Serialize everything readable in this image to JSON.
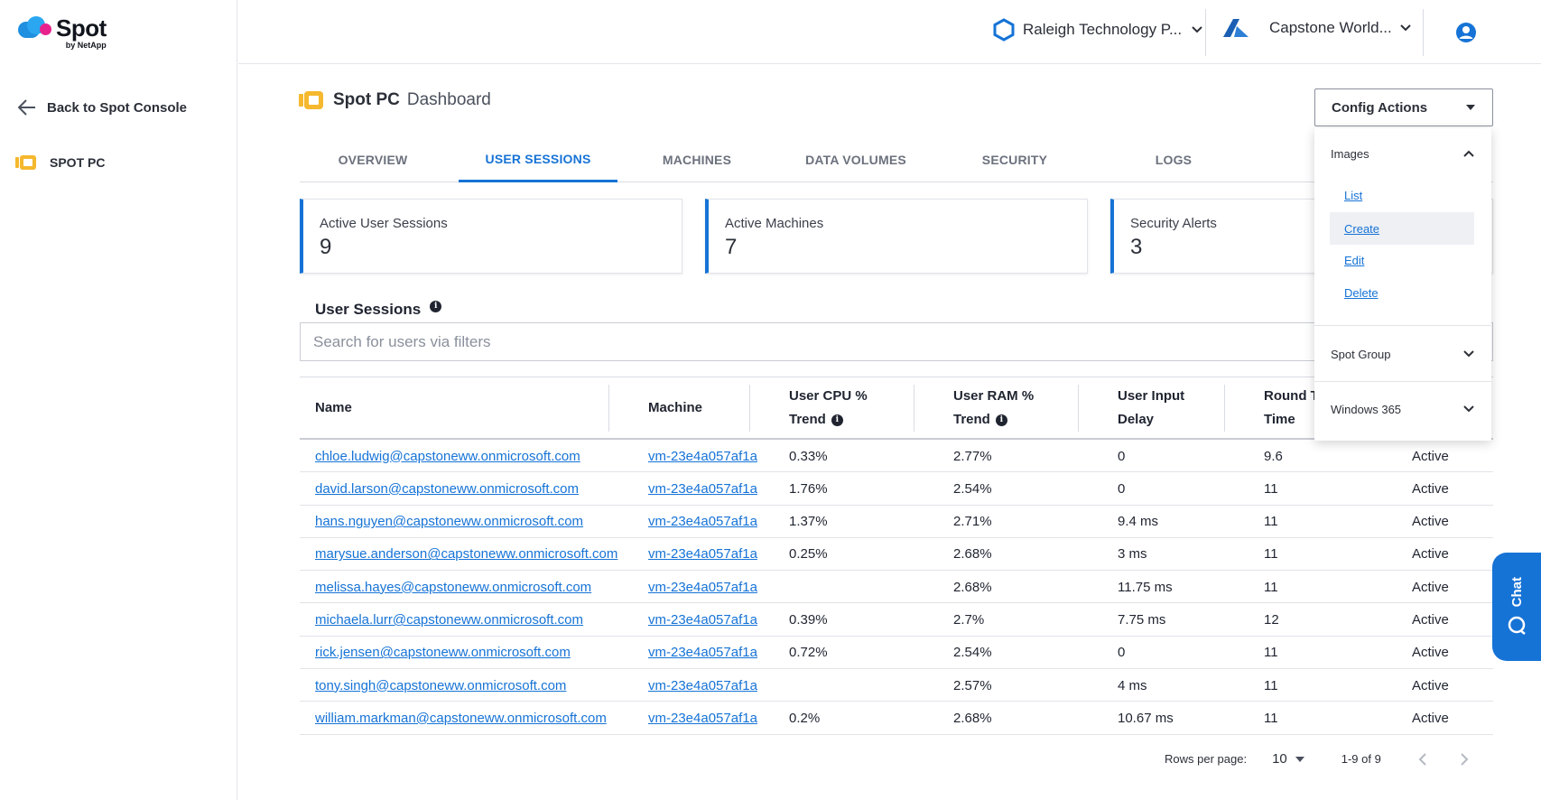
{
  "brand": {
    "name": "Spot",
    "sub": "by NetApp"
  },
  "sidebar": {
    "back_label": "Back to Spot Console",
    "items": [
      {
        "label": "SPOT PC"
      }
    ]
  },
  "topbar": {
    "org": "Raleigh Technology P...",
    "cloud_account": "Capstone World..."
  },
  "page": {
    "brand": "Spot PC",
    "title": "Dashboard"
  },
  "config_actions": {
    "label": "Config Actions",
    "groups": [
      {
        "label": "Images",
        "expanded": true,
        "items": [
          "List",
          "Create",
          "Edit",
          "Delete"
        ]
      },
      {
        "label": "Spot Group",
        "expanded": false
      },
      {
        "label": "Windows 365",
        "expanded": false
      }
    ]
  },
  "tabs": [
    "OVERVIEW",
    "USER SESSIONS",
    "MACHINES",
    "DATA VOLUMES",
    "SECURITY",
    "LOGS"
  ],
  "active_tab": "USER SESSIONS",
  "cards": [
    {
      "label": "Active User Sessions",
      "value": "9"
    },
    {
      "label": "Active Machines",
      "value": "7"
    },
    {
      "label": "Security Alerts",
      "value": "3"
    }
  ],
  "sessions": {
    "title": "User Sessions",
    "search_placeholder": "Search for users via filters",
    "columns": {
      "name": "Name",
      "machine": "Machine",
      "cpu_1": "User CPU %",
      "cpu_2": "Trend",
      "ram_1": "User RAM %",
      "ram_2": "Trend",
      "delay_1": "User Input",
      "delay_2": "Delay",
      "rt_1": "Round T",
      "rt_2": "Time"
    },
    "rows": [
      {
        "name": "chloe.ludwig@capstoneww.onmicrosoft.com",
        "machine": "vm-23e4a057af1a",
        "cpu": "0.33%",
        "ram": "2.77%",
        "delay": "0",
        "rt": "9.6",
        "status": "Active"
      },
      {
        "name": "david.larson@capstoneww.onmicrosoft.com",
        "machine": "vm-23e4a057af1a",
        "cpu": "1.76%",
        "ram": "2.54%",
        "delay": "0",
        "rt": "11",
        "status": "Active"
      },
      {
        "name": "hans.nguyen@capstoneww.onmicrosoft.com",
        "machine": "vm-23e4a057af1a",
        "cpu": "1.37%",
        "ram": "2.71%",
        "delay": "9.4 ms",
        "rt": "11",
        "status": "Active"
      },
      {
        "name": "marysue.anderson@capstoneww.onmicrosoft.com",
        "machine": "vm-23e4a057af1a",
        "cpu": "0.25%",
        "ram": "2.68%",
        "delay": "3 ms",
        "rt": "11",
        "status": "Active"
      },
      {
        "name": "melissa.hayes@capstoneww.onmicrosoft.com",
        "machine": "vm-23e4a057af1a",
        "cpu": "",
        "ram": "2.68%",
        "delay": "11.75 ms",
        "rt": "11",
        "status": "Active"
      },
      {
        "name": "michaela.lurr@capstoneww.onmicrosoft.com",
        "machine": "vm-23e4a057af1a",
        "cpu": "0.39%",
        "ram": "2.7%",
        "delay": "7.75 ms",
        "rt": "12",
        "status": "Active"
      },
      {
        "name": "rick.jensen@capstoneww.onmicrosoft.com",
        "machine": "vm-23e4a057af1a",
        "cpu": "0.72%",
        "ram": "2.54%",
        "delay": "0",
        "rt": "11",
        "status": "Active"
      },
      {
        "name": "tony.singh@capstoneww.onmicrosoft.com",
        "machine": "vm-23e4a057af1a",
        "cpu": "",
        "ram": "2.57%",
        "delay": "4 ms",
        "rt": "11",
        "status": "Active"
      },
      {
        "name": "william.markman@capstoneww.onmicrosoft.com",
        "machine": "vm-23e4a057af1a",
        "cpu": "0.2%",
        "ram": "2.68%",
        "delay": "10.67 ms",
        "rt": "11",
        "status": "Active"
      }
    ]
  },
  "pagination": {
    "rows_per_page_label": "Rows per page:",
    "rows_per_page": "10",
    "range": "1-9 of 9"
  },
  "chat": {
    "label": "Chat"
  },
  "colors": {
    "accent": "#1673d6",
    "brand_yellow": "#f5b82e"
  }
}
